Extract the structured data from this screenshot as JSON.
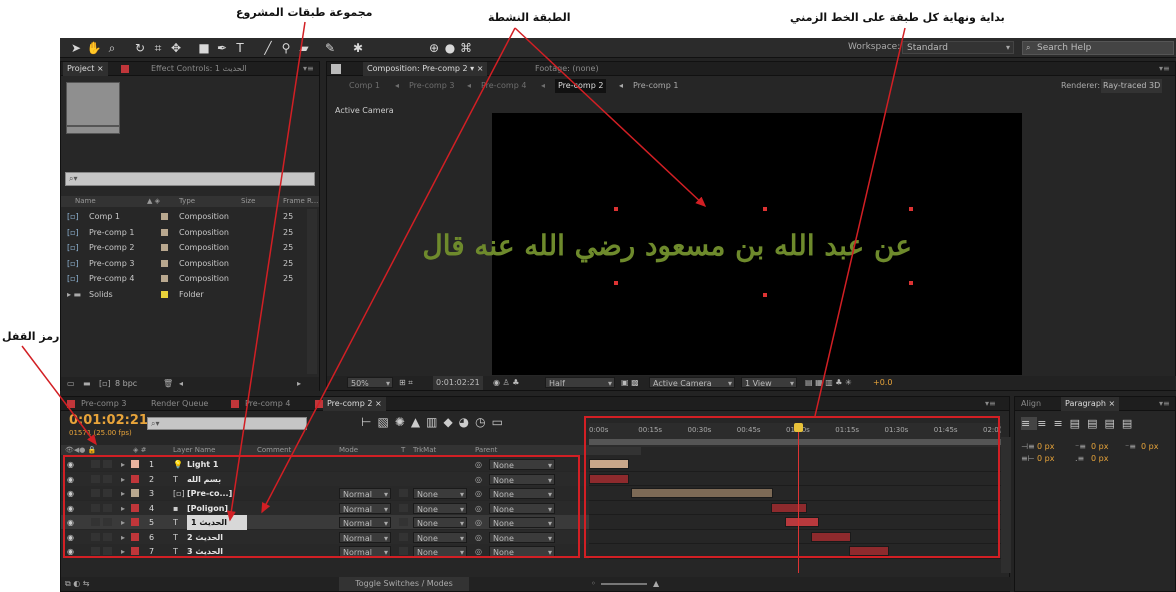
{
  "annotations": {
    "project_group": "مجموعة طبقات المشروع",
    "active_layer": "الطبقة النشطة",
    "layer_timeline": "بداية ونهاية كل طبقة على الخط الزمني",
    "lock_symbol": "رمز القفل"
  },
  "toolbar": {
    "workspace_label": "Workspace:",
    "workspace_value": "Standard",
    "search_placeholder": "Search Help"
  },
  "project_panel": {
    "tab_project": "Project",
    "tab_effect": "Effect Controls: الحديث 1",
    "columns": [
      "Name",
      "Type",
      "Size",
      "Frame R..."
    ],
    "items": [
      {
        "name": "Comp 1",
        "type": "Composition",
        "rate": "25",
        "color": "#b9a88f"
      },
      {
        "name": "Pre-comp 1",
        "type": "Composition",
        "rate": "25",
        "color": "#b9a88f"
      },
      {
        "name": "Pre-comp 2",
        "type": "Composition",
        "rate": "25",
        "color": "#b9a88f"
      },
      {
        "name": "Pre-comp 3",
        "type": "Composition",
        "rate": "25",
        "color": "#b9a88f"
      },
      {
        "name": "Pre-comp 4",
        "type": "Composition",
        "rate": "25",
        "color": "#b9a88f"
      },
      {
        "name": "Solids",
        "type": "Folder",
        "rate": "",
        "color": "#e8d23a"
      }
    ],
    "bpc": "8 bpc"
  },
  "composition_panel": {
    "tab_comp": "Composition: Pre-comp 2",
    "tab_footage": "Footage: (none)",
    "breadcrumbs": [
      "Comp 1",
      "Pre-comp 3",
      "Pre-comp 4",
      "Pre-comp 2",
      "Pre-comp 1"
    ],
    "renderer_label": "Renderer:",
    "renderer_value": "Ray-traced 3D",
    "camera_label": "Active Camera",
    "canvas_text": "عن عبد الله بن مسعود رضي الله عنه قال",
    "zoom": "50%",
    "timecode": "0:01:02:21",
    "resolution": "Half",
    "view_camera": "Active Camera",
    "view_count": "1 View",
    "exposure": "+0.0"
  },
  "timeline_panel": {
    "tabs": [
      "Pre-comp 3",
      "Render Queue",
      "Pre-comp 4",
      "Pre-comp 2"
    ],
    "timecode": "0:01:02:21",
    "frame_info": "01571 (25.00 fps)",
    "headers": {
      "layer_name": "Layer Name",
      "comment": "Comment",
      "mode": "Mode",
      "t": "T",
      "trkmat": "TrkMat",
      "parent": "Parent"
    },
    "layers": [
      {
        "num": "1",
        "name": "Light 1",
        "mode": "",
        "trkmat": "",
        "parent": "None",
        "color": "#e9b4a0"
      },
      {
        "num": "2",
        "name": "بسم الله",
        "mode": "",
        "trkmat": "",
        "parent": "None",
        "color": "#c0363a"
      },
      {
        "num": "3",
        "name": "[Pre-co...]",
        "mode": "Normal",
        "trkmat": "None",
        "parent": "None",
        "color": "#b9a88f"
      },
      {
        "num": "4",
        "name": "[Poligon]",
        "mode": "Normal",
        "trkmat": "None",
        "parent": "None",
        "color": "#c0363a"
      },
      {
        "num": "5",
        "name": "الحديث 1",
        "mode": "Normal",
        "trkmat": "None",
        "parent": "None",
        "color": "#c0363a"
      },
      {
        "num": "6",
        "name": "الحديث 2",
        "mode": "Normal",
        "trkmat": "None",
        "parent": "None",
        "color": "#c0363a"
      },
      {
        "num": "7",
        "name": "الحديث 3",
        "mode": "Normal",
        "trkmat": "None",
        "parent": "None",
        "color": "#c0363a"
      }
    ],
    "toggle_label": "Toggle Switches / Modes",
    "ruler": [
      "0:00s",
      "00:15s",
      "00:30s",
      "00:45s",
      "01:00s",
      "01:15s",
      "01:30s",
      "01:45s",
      "02:0("
    ]
  },
  "right_panel": {
    "tab_align": "Align",
    "tab_paragraph": "Paragraph",
    "indent_values": [
      "0 px",
      "0 px",
      "0 px",
      "0 px",
      "0 px"
    ]
  }
}
